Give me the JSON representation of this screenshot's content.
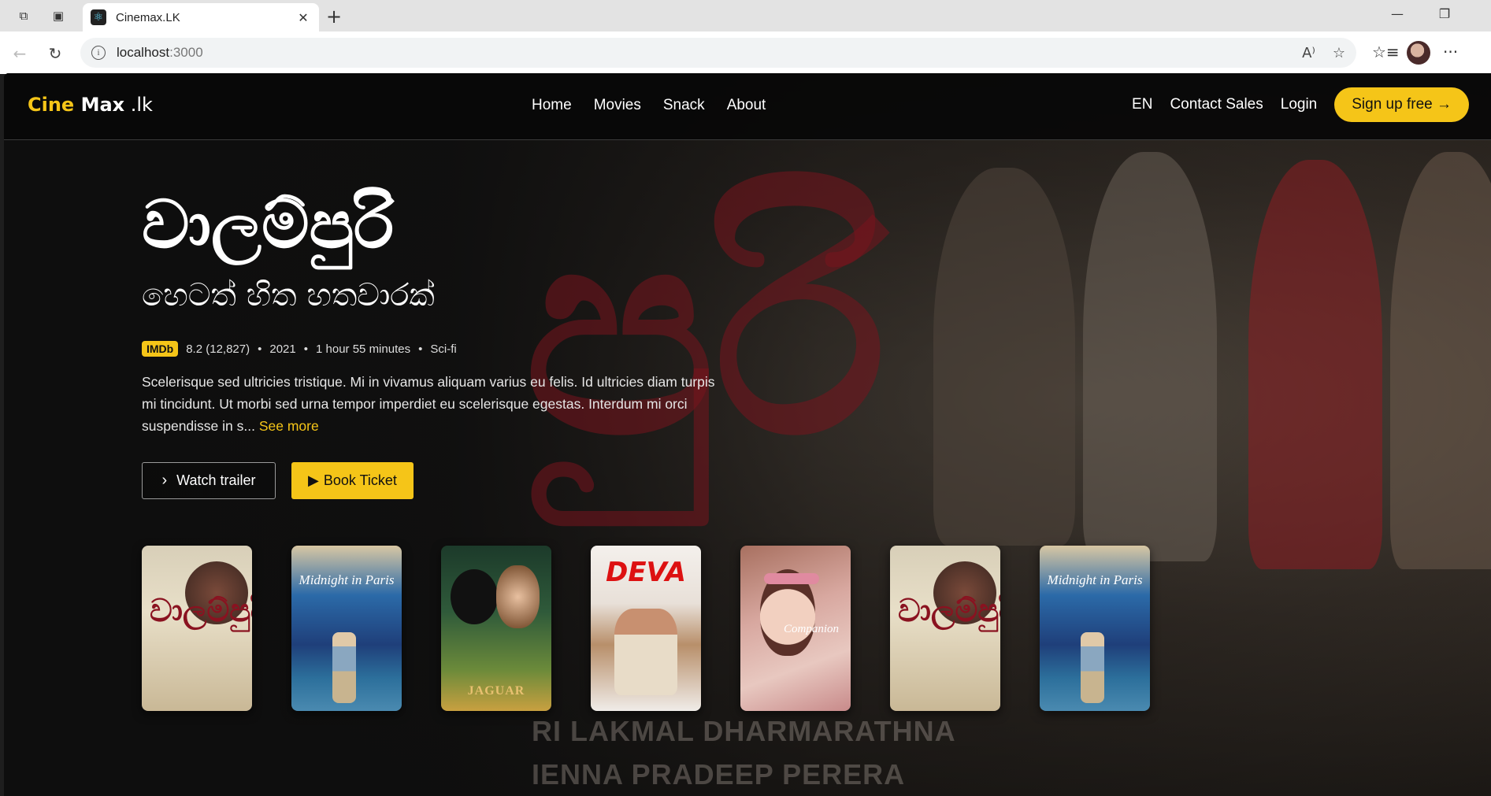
{
  "browser": {
    "tab_title": "Cinemax.LK",
    "favicon": "react-atom-icon",
    "url_host": "localhost",
    "url_port": ":3000"
  },
  "nav": {
    "logo_part1": "Cine",
    "logo_part2": "Max",
    "logo_part3": " .lk",
    "menu": [
      "Home",
      "Movies",
      "Snack",
      "About"
    ],
    "lang": "EN",
    "contact": "Contact Sales",
    "login": "Login",
    "signup": "Sign up free →"
  },
  "hero": {
    "title": "වාලම්පුරි",
    "subtitle": "හෙටත් හිත හතවාරක්",
    "imdb_badge": "IMDb",
    "rating": "8.2 (12,827)",
    "year": "2021",
    "duration": "1 hour 55 minutes",
    "genre": "Sci-fi",
    "description": "Scelerisque sed ultricies tristique. Mi in vivamus aliquam varius eu felis. Id ultricies diam turpis mi tincidunt. Ut morbi sed urna tempor imperdiet eu scelerisque egestas. Interdum mi orci suspendisse in s...",
    "see_more": "See more",
    "watch_trailer": "Watch trailer",
    "book_ticket": "Book Ticket"
  },
  "posters": [
    {
      "name": "Walampuri",
      "style": "vala",
      "label": "වාලම්පුරි"
    },
    {
      "name": "Midnight in Paris",
      "style": "paris",
      "label": "Midnight in Paris"
    },
    {
      "name": "Jaguar",
      "style": "jaguar",
      "label": "JAGUAR"
    },
    {
      "name": "Deva",
      "style": "deva",
      "label": "DEVA"
    },
    {
      "name": "Companion",
      "style": "comp",
      "label": "Companion"
    },
    {
      "name": "Walampuri",
      "style": "vala",
      "label": "වාලම්පුරි"
    },
    {
      "name": "Midnight in Paris",
      "style": "paris",
      "label": "Midnight in Paris"
    }
  ],
  "background": {
    "letters": "පුරි",
    "credits_1": "RI LAKMAL DHARMARATHNA",
    "credits_2": "IENNA    PRADEEP PERERA"
  },
  "colors": {
    "accent": "#f5c518"
  }
}
